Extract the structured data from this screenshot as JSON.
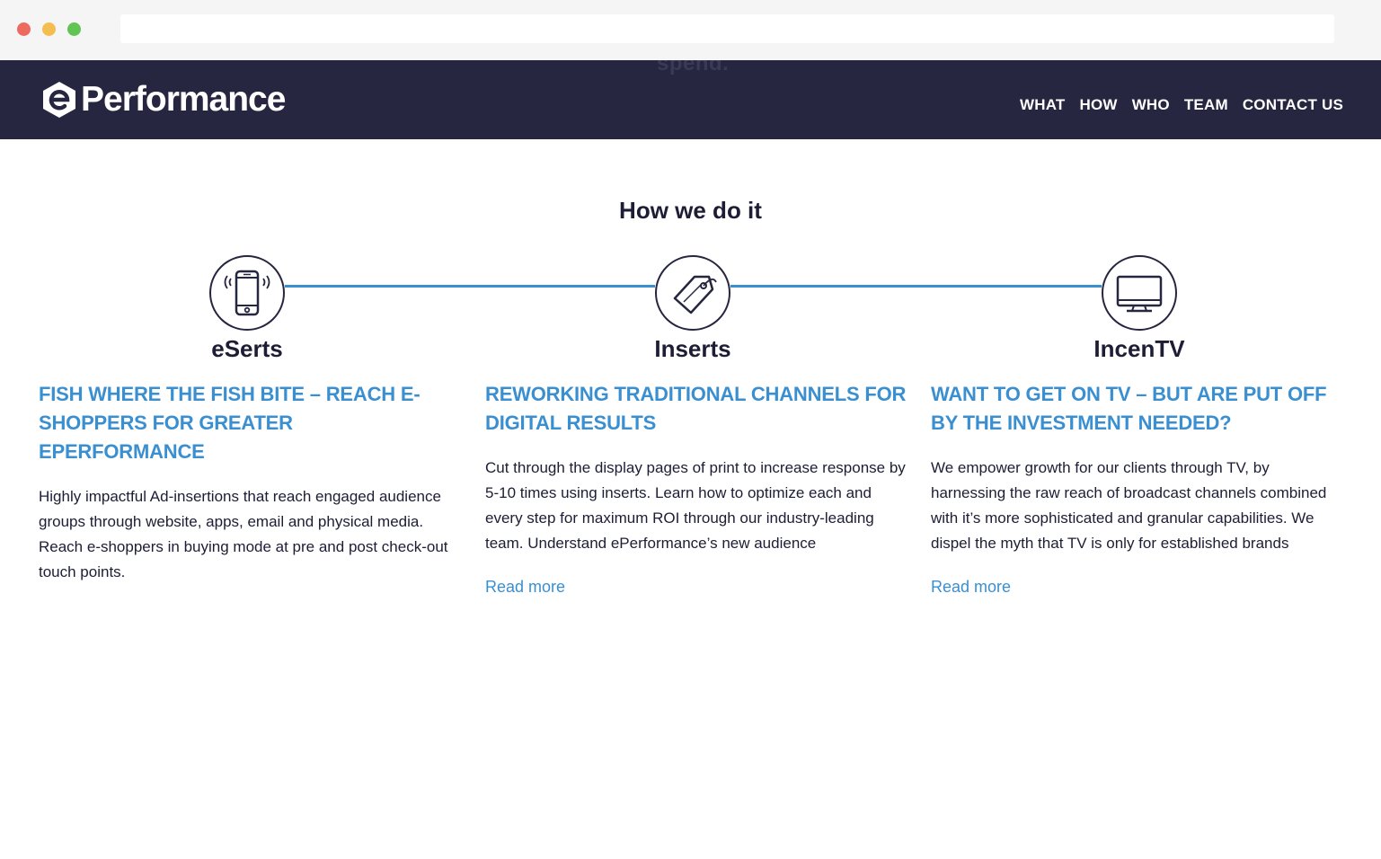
{
  "header": {
    "ghost_text": "spend.",
    "logo_text": "Performance",
    "nav": [
      "WHAT",
      "HOW",
      "WHO",
      "TEAM",
      "CONTACT US"
    ]
  },
  "section": {
    "title": "How we do it"
  },
  "columns": [
    {
      "name": "eSerts",
      "icon": "smartphone-icon",
      "heading": "FISH WHERE THE FISH BITE – REACH E-SHOPPERS FOR GREATER EPERFORMANCE",
      "body": "Highly impactful Ad-insertions that reach engaged audience groups through website, apps, email and physical media. Reach e-shoppers in buying mode at pre and post check-out touch points.",
      "link": ""
    },
    {
      "name": "Inserts",
      "icon": "tag-icon",
      "heading": "REWORKING TRADITIONAL CHANNELS FOR DIGITAL RESULTS",
      "body": "Cut through the display pages of print to increase response by 5-10 times using inserts. Learn how to optimize each and every step for maximum ROI through our industry-leading team. Understand ePerformance’s new audience",
      "link": "Read more"
    },
    {
      "name": "IncenTV",
      "icon": "tv-monitor-icon",
      "heading": "WANT TO GET ON TV – BUT ARE PUT OFF BY THE INVESTMENT NEEDED?",
      "body": "We empower growth for our clients through TV, by harnessing the raw reach of broadcast channels combined with it’s more sophisticated and granular capabilities. We dispel the myth that TV is only for established brands",
      "link": "Read more"
    }
  ],
  "colors": {
    "header_bg": "#262640",
    "accent": "#3a8fd1",
    "text": "#1d1d35"
  }
}
